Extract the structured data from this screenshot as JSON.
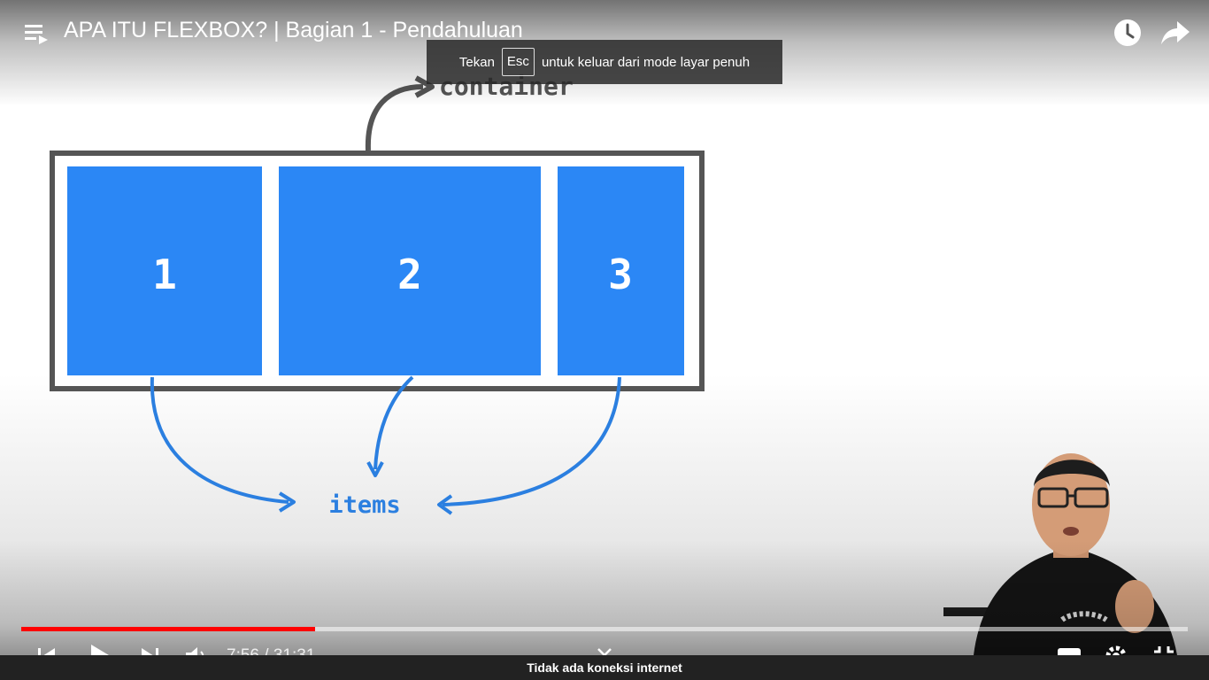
{
  "video": {
    "title": "APA ITU FLEXBOX? | Bagian 1 - Pendahuluan",
    "progress_fraction": 0.252,
    "time_display": "7:56 / 31:31"
  },
  "fullscreen_toast": {
    "prefix": "Tekan",
    "key": "Esc",
    "suffix": "untuk keluar dari mode layar penuh"
  },
  "diagram": {
    "container_label": "container",
    "items_label": "items",
    "items": [
      "1",
      "2",
      "3"
    ],
    "item_color": "#2b87f5",
    "arrow_color": "#2b7fe0",
    "frame_color": "#555555"
  },
  "status_bar": {
    "message": "Tidak ada koneksi internet"
  },
  "icons": {
    "playlist": "playlist-icon",
    "watch_later": "clock-icon",
    "share": "share-icon",
    "previous": "skip-previous-icon",
    "play": "play-icon",
    "next": "skip-next-icon",
    "volume": "volume-icon",
    "expand": "chevron-down-icon",
    "subtitles": "subtitles-icon",
    "settings": "gear-icon",
    "fullscreen": "fullscreen-exit-icon"
  },
  "colors": {
    "progress": "#ff0000",
    "status_bg": "#222222"
  }
}
